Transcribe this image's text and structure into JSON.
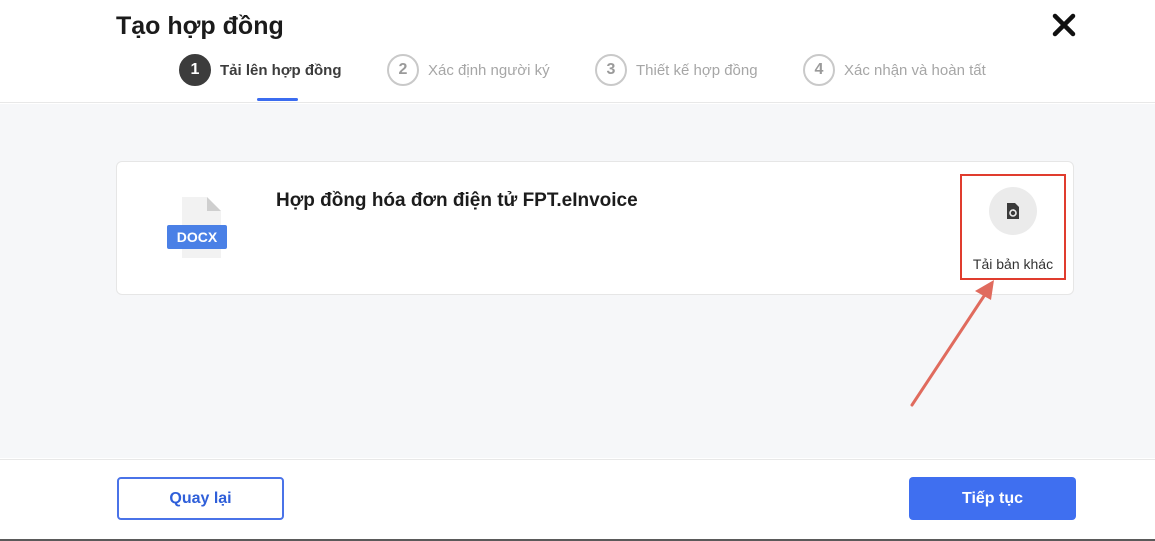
{
  "dialog": {
    "title": "Tạo hợp đồng",
    "close_icon": "close-icon"
  },
  "steps": [
    {
      "number": "1",
      "label": "Tải lên hợp đồng",
      "active": true
    },
    {
      "number": "2",
      "label": "Xác định người ký",
      "active": false
    },
    {
      "number": "3",
      "label": "Thiết kế hợp đồng",
      "active": false
    },
    {
      "number": "4",
      "label": "Xác nhận và hoàn tất",
      "active": false
    }
  ],
  "document": {
    "file_type": "DOCX",
    "name": "Hợp đồng hóa đơn điện tử FPT.eInvoice",
    "reupload_label": "Tải bản khác",
    "reupload_icon": "file-replace-icon"
  },
  "footer": {
    "back_label": "Quay lại",
    "next_label": "Tiếp tục"
  },
  "colors": {
    "accent": "#3f6ff0",
    "highlight": "#e03c2e",
    "arrow": "#e06b5e"
  }
}
